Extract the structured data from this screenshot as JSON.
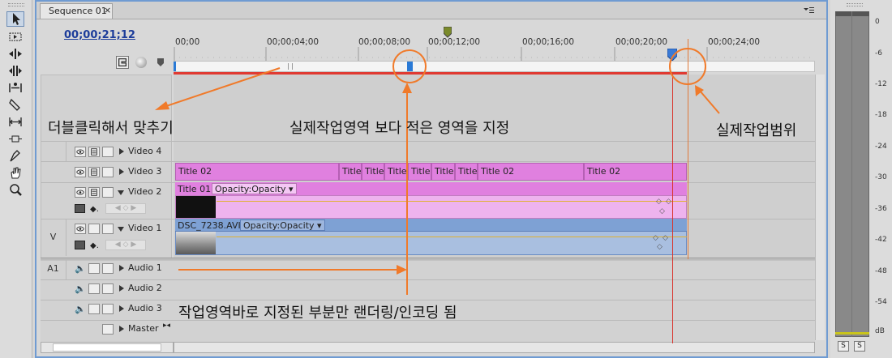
{
  "panel": {
    "tab_label": "Sequence 01"
  },
  "timecode": "00;00;21;12",
  "ruler": {
    "labels": [
      "00;00",
      "00;00;04;00",
      "00;00;08;00",
      "00;00;12;00",
      "00;00;16;00",
      "00;00;20;00",
      "00;00;24;00"
    ]
  },
  "tracks": {
    "video4": "Video 4",
    "video3": "Video 3",
    "video2": "Video 2",
    "video1": "Video 1",
    "audio1": "Audio 1",
    "audio2": "Audio 2",
    "audio3": "Audio 3",
    "master": "Master",
    "v_target": "V",
    "a_target": "A1"
  },
  "clips": {
    "v3": [
      "Title 02",
      "Title",
      "Title",
      "Title",
      "Title",
      "Title",
      "Title",
      "Title 02",
      "Title 02"
    ],
    "v2_name": "Title 01",
    "v2_effect": "Opacity:Opacity",
    "v1_name": "DSC_7238.AVI",
    "v1_effect": "Opacity:Opacity"
  },
  "annotations": {
    "double_click": "더블클릭해서 맞추기",
    "smaller_area": "실제작업영역 보다 적은 영역을 지정",
    "work_range": "실제작업범위",
    "render_note": "작업영역바로 지정된 부분만 랜더링/인코딩 됨"
  },
  "meter": {
    "labels": [
      "0",
      "-6",
      "-12",
      "-18",
      "-24",
      "-30",
      "-36",
      "-42",
      "-48",
      "-54",
      "dB"
    ],
    "solo_left": "S",
    "solo_right": "S"
  },
  "colors": {
    "accent": "#6f9bd2",
    "title_clip": "#e080df",
    "video_clip": "#7ea1d4",
    "annotation": "#f07a2a",
    "playhead": "#d9332b",
    "timecode": "#1c3c9a"
  }
}
